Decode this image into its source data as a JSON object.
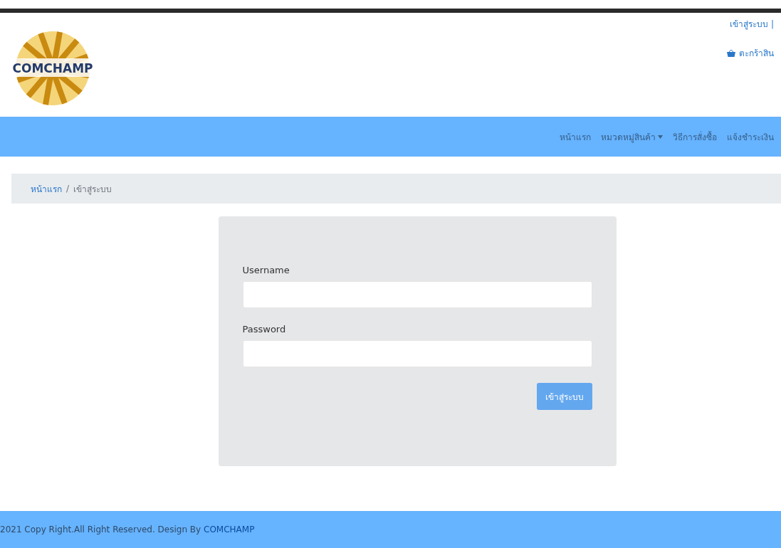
{
  "header": {
    "logo_text": "COMCHAMP",
    "login_link": "เข้าสู่ระบบ |",
    "cart_link": "ตะกร้าสิน"
  },
  "nav": [
    {
      "label": "หน้าแรก",
      "dropdown": false
    },
    {
      "label": "หมวดหมู่สินค้า",
      "dropdown": true
    },
    {
      "label": "วิธีการสั่งซื้อ",
      "dropdown": false
    },
    {
      "label": "แจ้งชำระเงิน",
      "dropdown": false
    }
  ],
  "breadcrumb_separator": "/",
  "breadcrumb": [
    {
      "label": "หน้าแรก",
      "link": true
    },
    {
      "label": "เข้าสู่ระบบ",
      "link": false
    }
  ],
  "login_form": {
    "username_label": "Username",
    "password_label": "Password",
    "submit": "เข้าสู่ระบบ"
  },
  "footer": {
    "text": "2021 Copy Right.All Right Reserved. Design By ",
    "link": "COMCHAMP"
  }
}
